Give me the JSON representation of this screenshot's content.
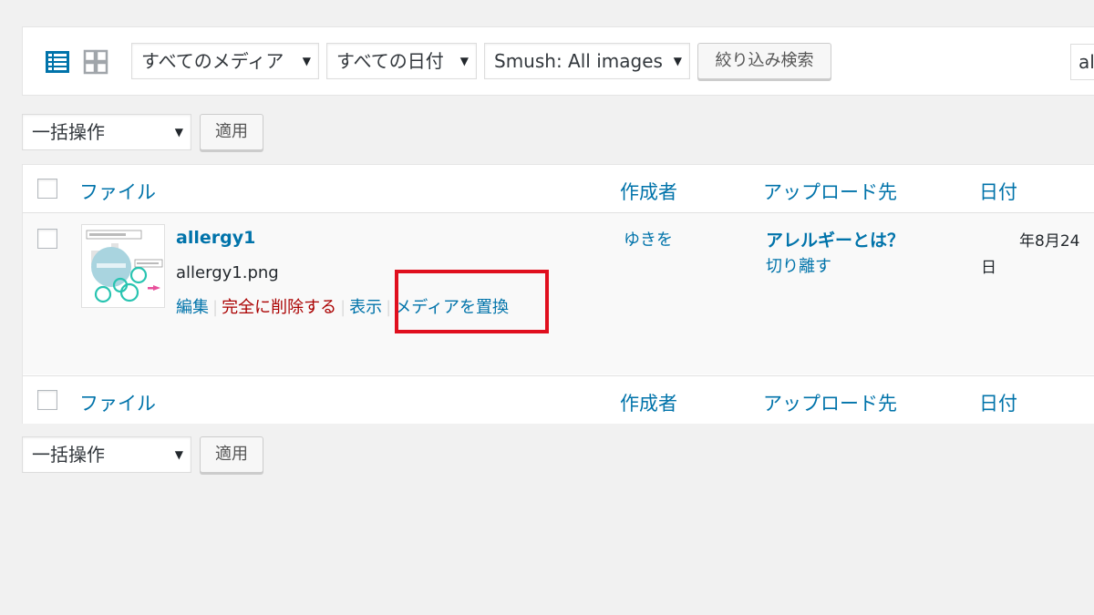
{
  "filters": {
    "media_type": "すべてのメディア",
    "date": "すべての日付",
    "smush": "Smush: All images",
    "filter_button": "絞り込み検索",
    "search_value": "al"
  },
  "bulk_top": {
    "select": "一括操作",
    "apply": "適用"
  },
  "bulk_bottom": {
    "select": "一括操作",
    "apply": "適用"
  },
  "columns": {
    "file": "ファイル",
    "author": "作成者",
    "uploaded_to": "アップロード先",
    "date": "日付"
  },
  "row": {
    "title": "allergy1",
    "filename": "allergy1.png",
    "actions": {
      "edit": "編集",
      "delete": "完全に削除する",
      "view": "表示",
      "replace": "メディアを置換"
    },
    "author": "ゆきを",
    "uploaded_to": "アレルギーとは？",
    "detach": "切り離す",
    "date_line1": "年8月24",
    "date_line2": "日"
  },
  "colors": {
    "link": "#0073aa",
    "delete": "#a00000",
    "highlight": "#e00f1e"
  },
  "icons": {
    "list_view": "list-view-icon",
    "grid_view": "grid-view-icon",
    "dropdown": "▼"
  }
}
